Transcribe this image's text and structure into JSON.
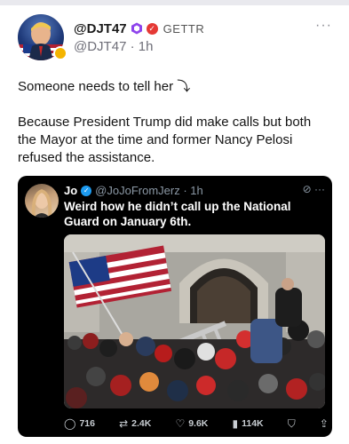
{
  "header": {
    "display_name": "@DJT47",
    "platform": "GETTR",
    "handle_time": "@DJT47 · 1h",
    "more": "···"
  },
  "post": {
    "line1": "Someone needs to tell her ⤵",
    "line2": "Because President Trump did make calls but both the Mayor at the time and former Nancy Pelosi refused the assistance."
  },
  "embed": {
    "name": "Jo",
    "handle_time": "@JoJoFromJerz · 1h",
    "actions": "⊘ ···",
    "text": "Weird how he didn’t call up the National Guard on January 6th.",
    "stats": {
      "replies": "716",
      "reposts": "2.4K",
      "likes": "9.6K",
      "views": "114K"
    }
  },
  "colors": {
    "twitter_blue": "#1d9bf0",
    "gettr_red": "#e53935",
    "embed_bg": "#000000"
  }
}
